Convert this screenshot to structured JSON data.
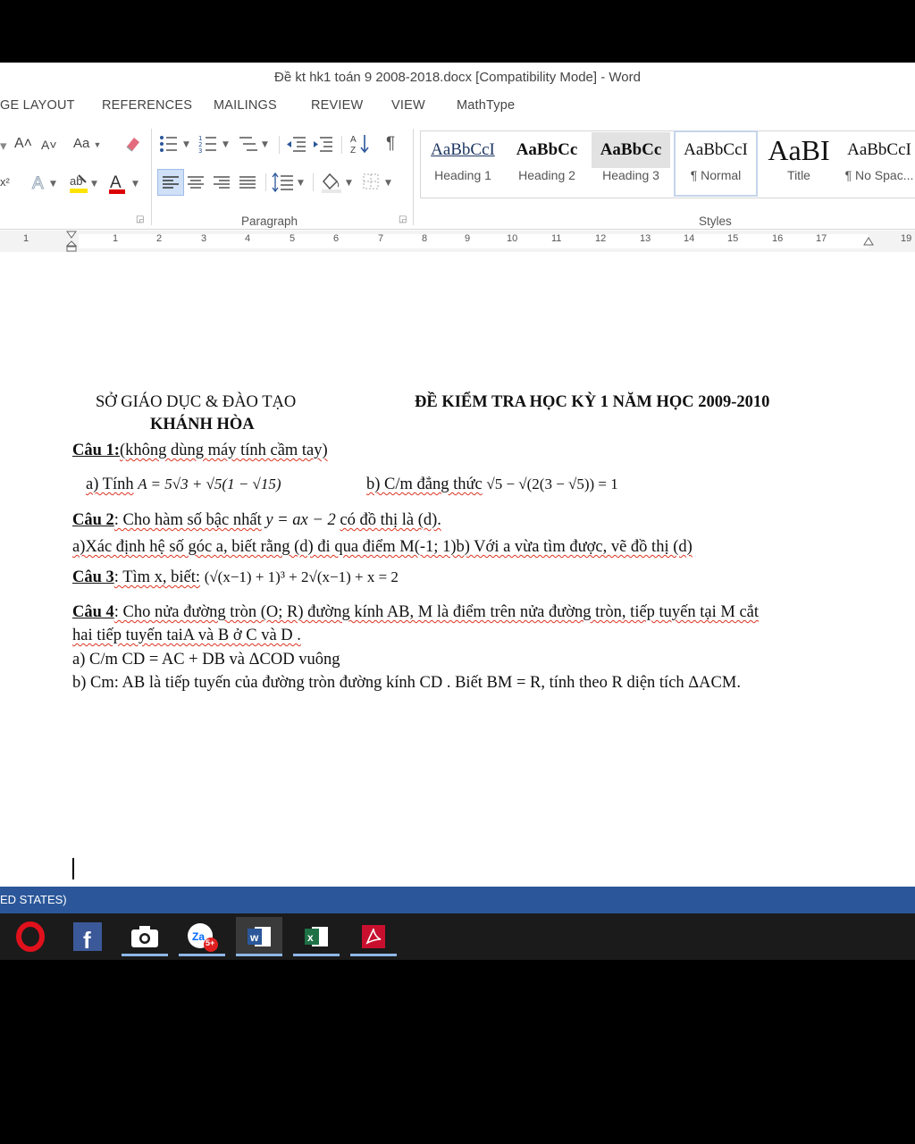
{
  "window": {
    "title": "Đề kt hk1 toán 9 2008-2018.docx [Compatibility Mode] - Word"
  },
  "tabs": [
    "GE LAYOUT",
    "REFERENCES",
    "MAILINGS",
    "REVIEW",
    "VIEW",
    "MathType"
  ],
  "ribbon": {
    "font_grow": "A˄",
    "font_shrink": "A˅",
    "change_case": "Aa",
    "groups": {
      "paragraph": "Paragraph",
      "styles": "Styles"
    },
    "styles": [
      {
        "sample": "AaBbCcI",
        "name": "Heading 1"
      },
      {
        "sample": "AaBbCc",
        "name": "Heading 2"
      },
      {
        "sample": "AaBbCc",
        "name": "Heading 3"
      },
      {
        "sample": "AaBbCcI",
        "name": "¶ Normal"
      },
      {
        "sample": "AaBI",
        "name": "Title"
      },
      {
        "sample": "AaBbCcI",
        "name": "¶ No Spac..."
      }
    ]
  },
  "ruler": {
    "numbers": [
      "1",
      "1",
      "2",
      "3",
      "4",
      "5",
      "6",
      "7",
      "8",
      "9",
      "10",
      "11",
      "12",
      "13",
      "14",
      "15",
      "16",
      "17",
      "19"
    ]
  },
  "document": {
    "header_left_1": "SỞ GIÁO DỤC & ĐÀO TẠO",
    "header_left_2": "KHÁNH HÒA",
    "header_right": "ĐỀ KIỂM TRA HỌC KỲ 1 NĂM HỌC 2009-2010",
    "q1_label": "Câu 1:",
    "q1_text": "(không dùng máy tính cầm tay)",
    "q1a_prefix": "a) Tính",
    "q1a_expr": "A = 5√3 + √5(1 − √15)",
    "q1b_prefix": "b) C/m đẳng thức",
    "q1b_expr": "√5 − √(2(3 − √5)) = 1",
    "q2_label": "Câu 2",
    "q2_text_1": ": Cho hàm số bậc nhất",
    "q2_expr": "y = ax − 2",
    "q2_text_2": "có đồ thị là (d).",
    "q2a": "a)Xác định hệ số góc a, biết rằng (d) đi qua điểm M(-1; 1)b) Với a vừa tìm được, vẽ đồ thị (d)",
    "q3_label": "Câu 3",
    "q3_text": ": Tìm x, biết:",
    "q3_expr": "(√(x−1) + 1)³ + 2√(x−1) + x = 2",
    "q4_label": "Câu 4",
    "q4_text_1": ": Cho nửa đường tròn (O; R) đường kính AB, M là điểm trên nửa đường tròn, tiếp tuyến tại M cắt",
    "q4_text_2": "hai tiếp tuyến taiA và B ở C và D .",
    "q4a": "a) C/m CD = AC + DB và ΔCOD vuông",
    "q4b": "b) Cm: AB là tiếp tuyến của đường tròn đường kính CD . Biết BM = R, tính theo R diện tích  ΔACM."
  },
  "statusbar": {
    "language": "ED STATES)"
  },
  "taskbar": {
    "icons": [
      "opera-icon",
      "facebook-icon",
      "camera-icon",
      "zalo-icon",
      "word-icon",
      "excel-icon",
      "acrobat-icon"
    ],
    "zalo_badge": "5+"
  },
  "colors": {
    "word_blue": "#2b579a",
    "taskbar": "#1b1b1b",
    "underline_accent": "#8db6e6"
  }
}
